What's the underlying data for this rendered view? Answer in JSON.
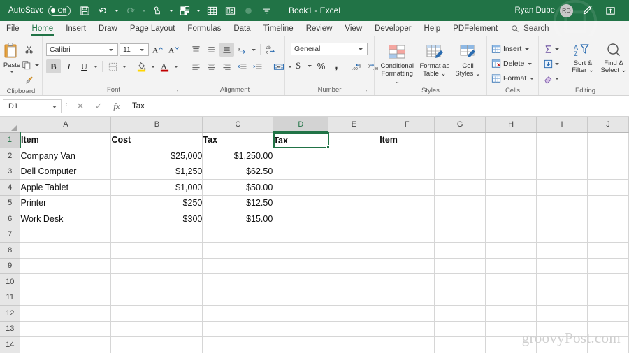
{
  "titlebar": {
    "autosave_label": "AutoSave",
    "autosave_state": "Off",
    "document_title": "Book1  -  Excel",
    "user_name": "Ryan Dube",
    "user_initials": "RD",
    "qat": [
      {
        "name": "save-icon",
        "label": "Save"
      },
      {
        "name": "undo-icon",
        "label": "Undo"
      },
      {
        "name": "redo-icon",
        "label": "Redo"
      },
      {
        "name": "touch-mode-icon",
        "label": "Touch/Mouse Mode"
      },
      {
        "name": "pivot-table-icon",
        "label": "PivotTable"
      },
      {
        "name": "table-icon",
        "label": "Table"
      },
      {
        "name": "form-icon",
        "label": "Form"
      },
      {
        "name": "record-macro-icon",
        "label": "Record Macro"
      },
      {
        "name": "customize-qat-icon",
        "label": "Customize Quick Access Toolbar"
      }
    ],
    "ribbon_display_options": "Ribbon Display Options",
    "pen_icon": "Draw with Ink"
  },
  "tabs": [
    {
      "label": "File",
      "active": false
    },
    {
      "label": "Home",
      "active": true
    },
    {
      "label": "Insert",
      "active": false
    },
    {
      "label": "Draw",
      "active": false
    },
    {
      "label": "Page Layout",
      "active": false
    },
    {
      "label": "Formulas",
      "active": false
    },
    {
      "label": "Data",
      "active": false
    },
    {
      "label": "Timeline",
      "active": false
    },
    {
      "label": "Review",
      "active": false
    },
    {
      "label": "View",
      "active": false
    },
    {
      "label": "Developer",
      "active": false
    },
    {
      "label": "Help",
      "active": false
    },
    {
      "label": "PDFelement",
      "active": false
    }
  ],
  "search": {
    "label": "Search",
    "icon": "search-icon"
  },
  "ribbon": {
    "clipboard": {
      "group_label": "Clipboard",
      "paste_label": "Paste",
      "cut_label": "Cut",
      "copy_label": "Copy",
      "format_painter_label": "Format Painter"
    },
    "font": {
      "group_label": "Font",
      "font_family": "Calibri",
      "font_size": "11",
      "grow_font": "A",
      "shrink_font": "A",
      "bold": "B",
      "italic": "I",
      "underline": "U",
      "borders_label": "Borders",
      "fill_color_label": "Fill Color",
      "font_color_label": "Font Color"
    },
    "alignment": {
      "group_label": "Alignment",
      "top_align": "Top Align",
      "middle_align": "Middle Align",
      "bottom_align": "Bottom Align",
      "orientation": "Orientation",
      "wrap_text": "Wrap Text",
      "align_left": "Align Left",
      "center": "Center",
      "align_right": "Align Right",
      "decrease_indent": "Decrease Indent",
      "increase_indent": "Increase Indent",
      "merge_center": "Merge & Center"
    },
    "number": {
      "group_label": "Number",
      "format": "General",
      "accounting": "$",
      "percent": "%",
      "comma": ",",
      "increase_decimal": "Increase Decimal",
      "decrease_decimal": "Decrease Decimal"
    },
    "styles": {
      "group_label": "Styles",
      "conditional_formatting": "Conditional\nFormatting",
      "conditional_formatting_l1": "Conditional",
      "conditional_formatting_l2": "Formatting",
      "format_as_table_l1": "Format as",
      "format_as_table_l2": "Table",
      "cell_styles_l1": "Cell",
      "cell_styles_l2": "Styles"
    },
    "cells": {
      "group_label": "Cells",
      "insert": "Insert",
      "delete": "Delete",
      "format": "Format"
    },
    "editing": {
      "group_label": "Editing",
      "autosum": "AutoSum",
      "fill": "Fill",
      "clear": "Clear",
      "sort_filter_l1": "Sort &",
      "sort_filter_l2": "Filter",
      "find_select_l1": "Find &",
      "find_select_l2": "Select"
    }
  },
  "formula_bar": {
    "name_box": "D1",
    "cancel": "✕",
    "enter": "✓",
    "insert_function": "fx",
    "content": "Tax"
  },
  "grid": {
    "columns": [
      {
        "label": "A",
        "width": 130,
        "selected": false
      },
      {
        "label": "B",
        "width": 131,
        "selected": false
      },
      {
        "label": "C",
        "width": 101,
        "selected": false
      },
      {
        "label": "D",
        "width": 79,
        "selected": true
      },
      {
        "label": "E",
        "width": 73,
        "selected": false
      },
      {
        "label": "F",
        "width": 79,
        "selected": false
      },
      {
        "label": "G",
        "width": 73,
        "selected": false
      },
      {
        "label": "H",
        "width": 73,
        "selected": false
      },
      {
        "label": "I",
        "width": 73,
        "selected": false
      },
      {
        "label": "J",
        "width": 59,
        "selected": false
      }
    ],
    "rows": [
      {
        "num": "1",
        "selected": true,
        "cells": [
          {
            "v": "Item",
            "bold": true,
            "align": "left"
          },
          {
            "v": "Cost",
            "bold": true,
            "align": "left"
          },
          {
            "v": "Tax",
            "bold": true,
            "align": "left"
          },
          {
            "v": "Tax",
            "bold": true,
            "align": "left"
          },
          {
            "v": "",
            "bold": false,
            "align": "left"
          },
          {
            "v": "Item",
            "bold": true,
            "align": "left"
          },
          {
            "v": "",
            "bold": false,
            "align": "left"
          },
          {
            "v": "",
            "bold": false,
            "align": "left"
          },
          {
            "v": "",
            "bold": false,
            "align": "left"
          },
          {
            "v": "",
            "bold": false,
            "align": "left"
          }
        ]
      },
      {
        "num": "2",
        "selected": false,
        "cells": [
          {
            "v": "Company Van",
            "bold": false,
            "align": "left"
          },
          {
            "v": "$25,000",
            "bold": false,
            "align": "right"
          },
          {
            "v": "$1,250.00",
            "bold": false,
            "align": "right"
          },
          {
            "v": "",
            "bold": false,
            "align": "left"
          },
          {
            "v": "",
            "bold": false,
            "align": "left"
          },
          {
            "v": "",
            "bold": false,
            "align": "left"
          },
          {
            "v": "",
            "bold": false,
            "align": "left"
          },
          {
            "v": "",
            "bold": false,
            "align": "left"
          },
          {
            "v": "",
            "bold": false,
            "align": "left"
          },
          {
            "v": "",
            "bold": false,
            "align": "left"
          }
        ]
      },
      {
        "num": "3",
        "selected": false,
        "cells": [
          {
            "v": "Dell Computer",
            "bold": false,
            "align": "left"
          },
          {
            "v": "$1,250",
            "bold": false,
            "align": "right"
          },
          {
            "v": "$62.50",
            "bold": false,
            "align": "right"
          },
          {
            "v": "",
            "bold": false,
            "align": "left"
          },
          {
            "v": "",
            "bold": false,
            "align": "left"
          },
          {
            "v": "",
            "bold": false,
            "align": "left"
          },
          {
            "v": "",
            "bold": false,
            "align": "left"
          },
          {
            "v": "",
            "bold": false,
            "align": "left"
          },
          {
            "v": "",
            "bold": false,
            "align": "left"
          },
          {
            "v": "",
            "bold": false,
            "align": "left"
          }
        ]
      },
      {
        "num": "4",
        "selected": false,
        "cells": [
          {
            "v": "Apple Tablet",
            "bold": false,
            "align": "left"
          },
          {
            "v": "$1,000",
            "bold": false,
            "align": "right"
          },
          {
            "v": "$50.00",
            "bold": false,
            "align": "right"
          },
          {
            "v": "",
            "bold": false,
            "align": "left"
          },
          {
            "v": "",
            "bold": false,
            "align": "left"
          },
          {
            "v": "",
            "bold": false,
            "align": "left"
          },
          {
            "v": "",
            "bold": false,
            "align": "left"
          },
          {
            "v": "",
            "bold": false,
            "align": "left"
          },
          {
            "v": "",
            "bold": false,
            "align": "left"
          },
          {
            "v": "",
            "bold": false,
            "align": "left"
          }
        ]
      },
      {
        "num": "5",
        "selected": false,
        "cells": [
          {
            "v": "Printer",
            "bold": false,
            "align": "left"
          },
          {
            "v": "$250",
            "bold": false,
            "align": "right"
          },
          {
            "v": "$12.50",
            "bold": false,
            "align": "right"
          },
          {
            "v": "",
            "bold": false,
            "align": "left"
          },
          {
            "v": "",
            "bold": false,
            "align": "left"
          },
          {
            "v": "",
            "bold": false,
            "align": "left"
          },
          {
            "v": "",
            "bold": false,
            "align": "left"
          },
          {
            "v": "",
            "bold": false,
            "align": "left"
          },
          {
            "v": "",
            "bold": false,
            "align": "left"
          },
          {
            "v": "",
            "bold": false,
            "align": "left"
          }
        ]
      },
      {
        "num": "6",
        "selected": false,
        "cells": [
          {
            "v": "Work Desk",
            "bold": false,
            "align": "left"
          },
          {
            "v": "$300",
            "bold": false,
            "align": "right"
          },
          {
            "v": "$15.00",
            "bold": false,
            "align": "right"
          },
          {
            "v": "",
            "bold": false,
            "align": "left"
          },
          {
            "v": "",
            "bold": false,
            "align": "left"
          },
          {
            "v": "",
            "bold": false,
            "align": "left"
          },
          {
            "v": "",
            "bold": false,
            "align": "left"
          },
          {
            "v": "",
            "bold": false,
            "align": "left"
          },
          {
            "v": "",
            "bold": false,
            "align": "left"
          },
          {
            "v": "",
            "bold": false,
            "align": "left"
          }
        ]
      },
      {
        "num": "7",
        "selected": false,
        "cells": []
      },
      {
        "num": "8",
        "selected": false,
        "cells": []
      },
      {
        "num": "9",
        "selected": false,
        "cells": []
      },
      {
        "num": "10",
        "selected": false,
        "cells": []
      },
      {
        "num": "11",
        "selected": false,
        "cells": []
      },
      {
        "num": "12",
        "selected": false,
        "cells": []
      },
      {
        "num": "13",
        "selected": false,
        "cells": []
      },
      {
        "num": "14",
        "selected": false,
        "cells": []
      }
    ],
    "active_cell": "D1"
  },
  "watermark": "groovyPost.com",
  "colors": {
    "excel_green": "#217346",
    "ribbon_bg": "#f3f3f3",
    "header_gray": "#e6e6e6",
    "selection_green": "#217346"
  }
}
